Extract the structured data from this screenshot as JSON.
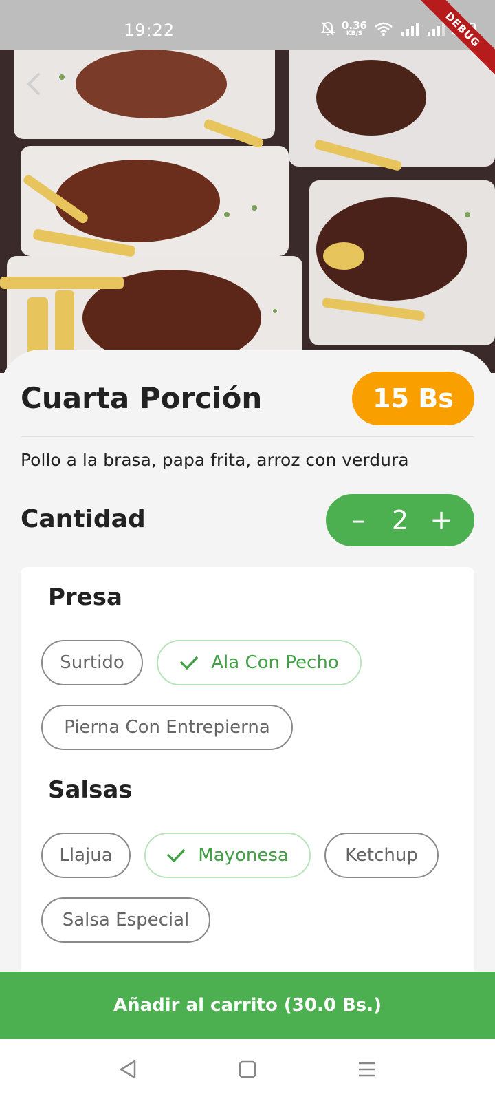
{
  "status_bar": {
    "time": "19:22",
    "net_speed_value": "0.36",
    "net_speed_unit": "KB/S",
    "battery": "75",
    "debug_label": "DEBUG"
  },
  "product": {
    "title": "Cuarta Porción",
    "price": "15 Bs",
    "description": "Pollo a la brasa, papa frita, arroz con verdura"
  },
  "quantity": {
    "label": "Cantidad",
    "value": "2",
    "minus": "–",
    "plus": "+"
  },
  "groups": [
    {
      "title": "Presa",
      "options": [
        {
          "label": "Surtido",
          "selected": false
        },
        {
          "label": "Ala Con Pecho",
          "selected": true
        },
        {
          "label": "Pierna Con Entrepierna",
          "selected": false
        }
      ]
    },
    {
      "title": "Salsas",
      "options": [
        {
          "label": "Llajua",
          "selected": false
        },
        {
          "label": "Mayonesa",
          "selected": true
        },
        {
          "label": "Ketchup",
          "selected": false
        },
        {
          "label": "Salsa Especial",
          "selected": false
        }
      ]
    }
  ],
  "cart_button": {
    "label": "Añadir al carrito (30.0 Bs.)"
  },
  "colors": {
    "accent_green": "#4caf50",
    "price_orange": "#f99f00"
  },
  "icons": {
    "back": "chevron-left-icon",
    "check": "check-icon",
    "nav_back": "triangle-back-icon",
    "nav_home": "square-home-icon",
    "nav_menu": "menu-icon"
  }
}
